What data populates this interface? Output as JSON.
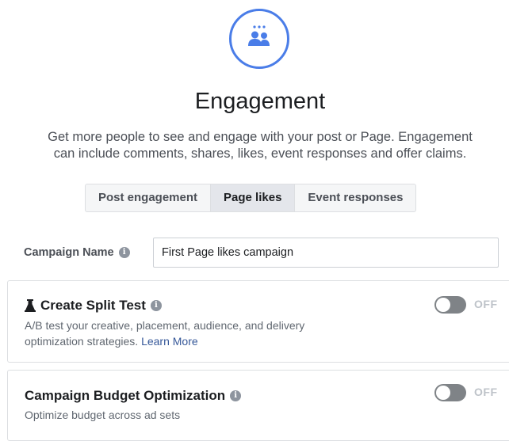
{
  "objective": {
    "icon": "people-group-icon",
    "accent_color": "#4a7de8",
    "title": "Engagement",
    "description_line1": "Get more people to see and engage with your post or Page. Engagement",
    "description_line2": "can include comments, shares, likes, event responses and offer claims."
  },
  "tabs": [
    {
      "label": "Post engagement",
      "active": false
    },
    {
      "label": "Page likes",
      "active": true
    },
    {
      "label": "Event responses",
      "active": false
    }
  ],
  "campaign_name": {
    "label": "Campaign Name",
    "value": "First Page likes campaign"
  },
  "split_test": {
    "icon": "flask-icon",
    "title": "Create Split Test",
    "description_line1": "A/B test your creative, placement, audience, and delivery",
    "description_line2": "optimization strategies.",
    "learn_more": "Learn More",
    "toggle_state": "OFF"
  },
  "budget_optimization": {
    "title": "Campaign Budget Optimization",
    "description": "Optimize budget across ad sets",
    "toggle_state": "OFF"
  }
}
